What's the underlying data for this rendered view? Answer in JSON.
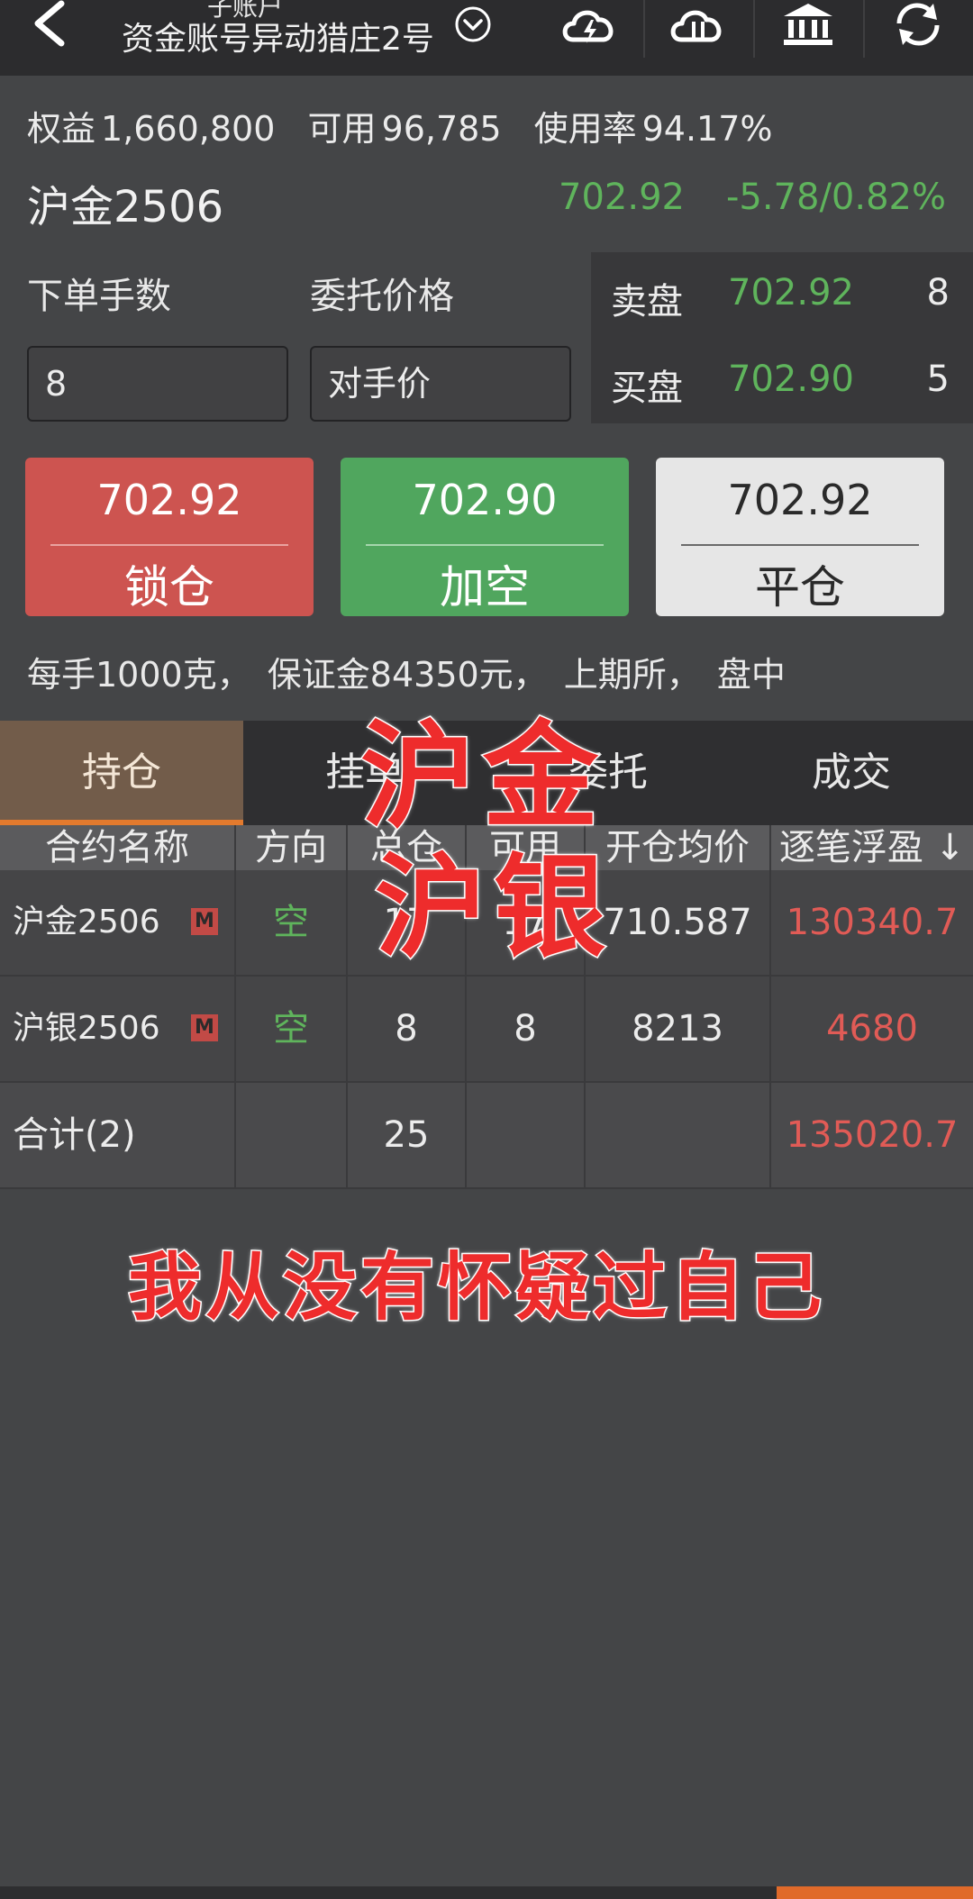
{
  "header": {
    "account_prefix": "子账户",
    "account_name": "资金账号异动猎庄2号"
  },
  "account": {
    "equity_label": "权益",
    "equity": "1,660,800",
    "available_label": "可用",
    "available": "96,785",
    "usage_label": "使用率",
    "usage": "94.17%"
  },
  "quote": {
    "contract": "沪金2506",
    "last_price": "702.92",
    "change": "-5.78/0.82%"
  },
  "order": {
    "lots_label": "下单手数",
    "price_label": "委托价格",
    "lots_value": "8",
    "price_value": "对手价"
  },
  "book": {
    "ask_label": "卖盘",
    "ask_price": "702.92",
    "ask_qty": "8",
    "bid_label": "买盘",
    "bid_price": "702.90",
    "bid_qty": "5"
  },
  "buttons": {
    "lock": {
      "price": "702.92",
      "label": "锁仓"
    },
    "add_short": {
      "price": "702.90",
      "label": "加空"
    },
    "close": {
      "price": "702.92",
      "label": "平仓"
    }
  },
  "spec_text": "每手1000克， 保证金84350元， 上期所， 盘中",
  "tabs": [
    "持仓",
    "挂单",
    "委托",
    "成交"
  ],
  "table": {
    "headers": [
      "合约名称",
      "方向",
      "总仓",
      "可用",
      "开仓均价",
      "逐笔浮盈 ↓"
    ],
    "rows": [
      {
        "name": "沪金2506",
        "badge": "M",
        "direction": "空",
        "total": "17",
        "available": "17",
        "avg_price": "710.587",
        "pnl": "130340.7"
      },
      {
        "name": "沪银2506",
        "badge": "M",
        "direction": "空",
        "total": "8",
        "available": "8",
        "avg_price": "8213",
        "pnl": "4680"
      }
    ],
    "total_row": {
      "label": "合计(2)",
      "total": "25",
      "pnl": "135020.7"
    }
  },
  "overlay": {
    "line1": "沪金",
    "line2": "沪银",
    "line3": "我从没有怀疑过自己"
  },
  "colors": {
    "up_green": "#5fb45c",
    "down_red": "#e15b56",
    "lock_red": "#cd5450",
    "add_green": "#50a65e",
    "active_tab": "#725c4a",
    "accent_orange": "#e27a2e"
  },
  "icons": [
    "back-arrow-icon",
    "chevron-down-icon",
    "cloud-lightning-icon",
    "cloud-sync-icon",
    "bank-icon",
    "refresh-icon"
  ]
}
